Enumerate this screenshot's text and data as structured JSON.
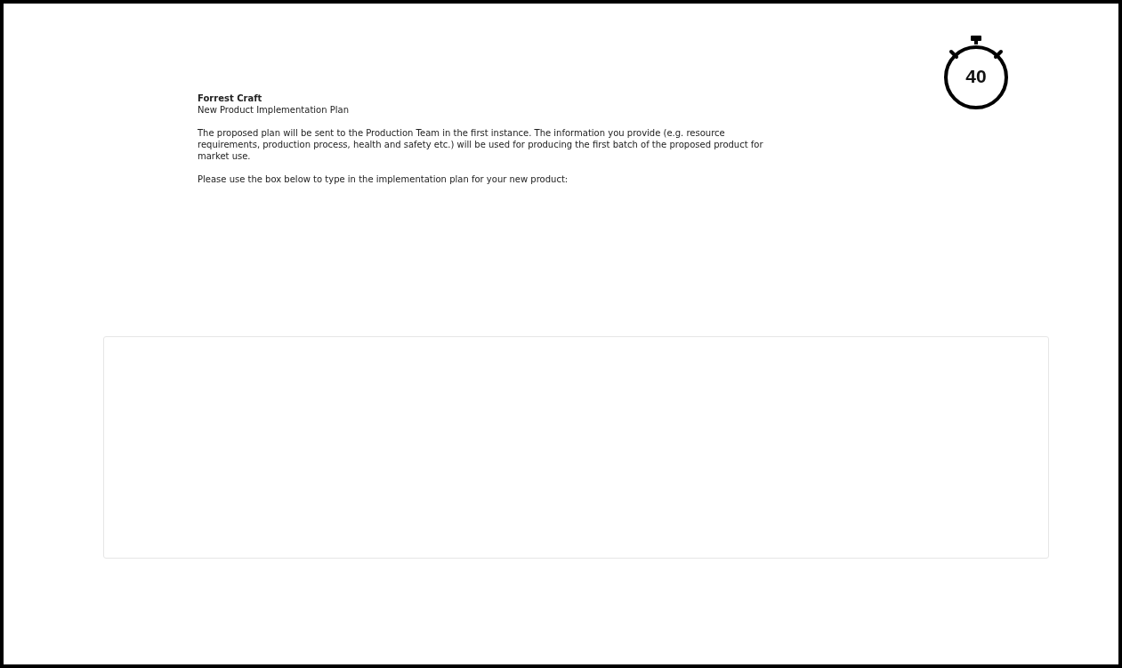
{
  "header": {
    "company": "Forrest Craft",
    "subtitle": "New Product Implementation Plan"
  },
  "paragraphs": [
    "The proposed plan will be sent to the Production Team in the first instance. The information you provide (e.g. resource requirements, production process, health and safety etc.) will be used for producing the first batch of the proposed product for market use.",
    "Please use the box below to type in the implementation plan for your new product:"
  ],
  "timer": {
    "value": "40"
  }
}
